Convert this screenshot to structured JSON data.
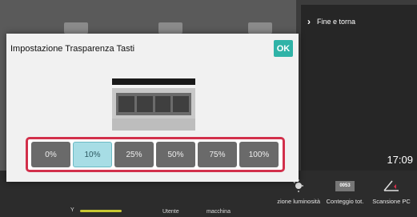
{
  "dialog": {
    "title": "Impostazione Trasparenza Tasti",
    "ok_label": "OK",
    "options": [
      "0%",
      "10%",
      "25%",
      "50%",
      "75%",
      "100%"
    ],
    "selected": "10%"
  },
  "side_panel": {
    "fine_label": "Fine e torna",
    "clock": "17:09"
  },
  "bottom_bar": {
    "functions": [
      {
        "label": "zione luminosità",
        "icon": "brightness-icon"
      },
      {
        "label": "Conteggio tot.",
        "icon": "counter-icon"
      },
      {
        "label": "Scansione PC",
        "icon": "scan-pc-icon"
      }
    ],
    "counter_icon_text": "0053",
    "labels": [
      "Utente",
      "macchina"
    ],
    "slider_letter": "Y"
  },
  "colors": {
    "ok": "#2fb3a7",
    "selected_option": "#a7dde5",
    "highlight_border": "#d2304b"
  }
}
